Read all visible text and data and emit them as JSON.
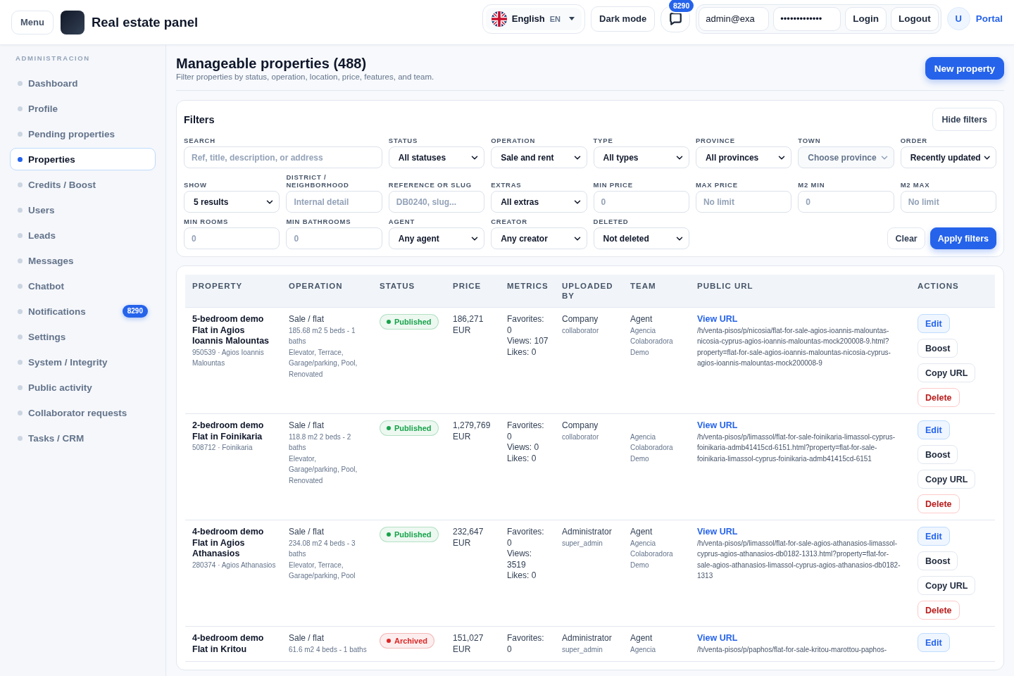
{
  "header": {
    "menu_button": "Menu",
    "title": "Real estate panel",
    "language": {
      "name": "English",
      "code": "EN"
    },
    "dark_mode_button": "Dark mode",
    "notifications": {
      "count": "8290"
    },
    "login": {
      "email": "admin@exa",
      "password": "•••••••••••••",
      "buttons": [
        "Login",
        "Logout"
      ]
    },
    "avatar": "U",
    "portal_link": "Portal"
  },
  "sidebar": {
    "section": "ADMINISTRACION",
    "items": [
      {
        "label": "Dashboard",
        "selected": false
      },
      {
        "label": "Profile",
        "selected": false
      },
      {
        "label": "Pending properties",
        "selected": false
      },
      {
        "label": "Properties",
        "selected": true
      },
      {
        "label": "Credits / Boost",
        "selected": false
      },
      {
        "label": "Users",
        "selected": false
      },
      {
        "label": "Leads",
        "selected": false
      },
      {
        "label": "Messages",
        "selected": false
      },
      {
        "label": "Chatbot",
        "selected": false
      },
      {
        "label": "Notifications",
        "selected": false,
        "badge": "8290"
      },
      {
        "label": "Settings",
        "selected": false
      },
      {
        "label": "System / Integrity",
        "selected": false
      },
      {
        "label": "Public activity",
        "selected": false
      },
      {
        "label": "Collaborator requests",
        "selected": false
      },
      {
        "label": "Tasks / CRM",
        "selected": false
      }
    ]
  },
  "page": {
    "title": "Manageable properties (488)",
    "subtitle": "Filter properties by status, operation, location, price, features, and team.",
    "new_button": "New property"
  },
  "filters": {
    "heading": "Filters",
    "hide_button": "Hide filters",
    "fields": [
      {
        "label": "SEARCH",
        "kind": "search",
        "placeholder": "Ref, title, description, or address",
        "disabled": false
      },
      {
        "label": "STATUS",
        "kind": "select",
        "value": "All statuses",
        "disabled": false
      },
      {
        "label": "OPERATION",
        "kind": "select",
        "value": "Sale and rent",
        "disabled": false
      },
      {
        "label": "TYPE",
        "kind": "select",
        "value": "All types",
        "disabled": false
      },
      {
        "label": "PROVINCE",
        "kind": "select",
        "value": "All provinces",
        "disabled": false
      },
      {
        "label": "TOWN",
        "kind": "select",
        "value": "Choose province",
        "disabled": true
      },
      {
        "label": "ORDER",
        "kind": "select",
        "value": "Recently updated",
        "disabled": false
      },
      {
        "label": "SHOW",
        "kind": "select",
        "value": "5 results",
        "disabled": false
      },
      {
        "label": "DISTRICT / NEIGHBORHOOD",
        "kind": "input",
        "placeholder": "Internal detail",
        "disabled": false
      },
      {
        "label": "REFERENCE OR SLUG",
        "kind": "input",
        "placeholder": "DB0240, slug...",
        "disabled": false
      },
      {
        "label": "EXTRAS",
        "kind": "select",
        "value": "All extras",
        "disabled": false
      },
      {
        "label": "MIN PRICE",
        "kind": "input",
        "placeholder": "0",
        "disabled": false
      },
      {
        "label": "MAX PRICE",
        "kind": "input",
        "placeholder": "No limit",
        "disabled": false
      },
      {
        "label": "M2 MIN",
        "kind": "input",
        "placeholder": "0",
        "disabled": false
      },
      {
        "label": "M2 MAX",
        "kind": "input",
        "placeholder": "No limit",
        "disabled": false
      },
      {
        "label": "MIN ROOMS",
        "kind": "input",
        "placeholder": "0",
        "disabled": false
      },
      {
        "label": "MIN BATHROOMS",
        "kind": "input",
        "placeholder": "0",
        "disabled": false
      },
      {
        "label": "AGENT",
        "kind": "select",
        "value": "Any agent",
        "disabled": false
      },
      {
        "label": "CREATOR",
        "kind": "select",
        "value": "Any creator",
        "disabled": false
      },
      {
        "label": "DELETED",
        "kind": "select",
        "value": "Not deleted",
        "disabled": false
      }
    ],
    "actions": [
      {
        "label": "Clear",
        "kind": "reset"
      },
      {
        "label": "Apply filters",
        "kind": "submit"
      }
    ]
  },
  "table": {
    "columns": [
      "PROPERTY",
      "OPERATION",
      "STATUS",
      "PRICE",
      "METRICS",
      "UPLOADED BY",
      "TEAM",
      "PUBLIC URL",
      "ACTIONS"
    ],
    "rows": [
      {
        "property": {
          "title": "5-bedroom demo Flat in Agios Ioannis Malountas",
          "meta": "950539 · Agios Ioannis Malountas"
        },
        "operation": {
          "type": "Sale / flat",
          "details": "185.68 m2 5 beds - 1 baths",
          "features": "Elevator, Terrace, Garage/parking, Pool, Renovated"
        },
        "status": {
          "label": "Published",
          "color": "#16a34a"
        },
        "price": "186,271 EUR",
        "metrics": [
          "Favorites: 0",
          "Views: 107",
          "Likes: 0"
        ],
        "uploaded_by": {
          "name": "Company",
          "role": "collaborator"
        },
        "team": {
          "agent": "Agent",
          "name": "Agencia Colaboradora Demo"
        },
        "public_url": {
          "link": "View URL",
          "path": "/h/venta-pisos/p/nicosia/flat-for-sale-agios-ioannis-malountas-nicosia-cyprus-agios-ioannis-malountas-mock200008-9.html?property=flat-for-sale-agios-ioannis-malountas-nicosia-cyprus-agios-ioannis-malountas-mock200008-9"
        },
        "actions": [
          {
            "label": "Edit",
            "kind": "edit"
          },
          {
            "label": "Boost",
            "kind": "boost"
          },
          {
            "label": "Copy URL",
            "kind": "copy"
          },
          {
            "label": "Delete",
            "kind": "delete"
          }
        ]
      },
      {
        "property": {
          "title": "2-bedroom demo Flat in Foinikaria",
          "meta": "508712 · Foinikaria"
        },
        "operation": {
          "type": "Sale / flat",
          "details": "118.8 m2 2 beds - 2 baths",
          "features": "Elevator, Garage/parking, Pool, Renovated"
        },
        "status": {
          "label": "Published",
          "color": "#16a34a"
        },
        "price": "1,279,769 EUR",
        "metrics": [
          "Favorites: 0",
          "Views: 0",
          "Likes: 0"
        ],
        "uploaded_by": {
          "name": "Company",
          "role": "collaborator"
        },
        "team": {
          "name": "Agencia Colaboradora Demo"
        },
        "public_url": {
          "link": "View URL",
          "path": "/h/venta-pisos/p/limassol/flat-for-sale-foinikaria-limassol-cyprus-foinikaria-admb41415cd-6151.html?property=flat-for-sale-foinikaria-limassol-cyprus-foinikaria-admb41415cd-6151"
        },
        "actions": [
          {
            "label": "Edit",
            "kind": "edit"
          },
          {
            "label": "Boost",
            "kind": "boost"
          },
          {
            "label": "Copy URL",
            "kind": "copy"
          },
          {
            "label": "Delete",
            "kind": "delete"
          }
        ]
      },
      {
        "property": {
          "title": "4-bedroom demo Flat in Agios Athanasios",
          "meta": "280374 · Agios Athanasios"
        },
        "operation": {
          "type": "Sale / flat",
          "details": "234.08 m2 4 beds - 3 baths",
          "features": "Elevator, Terrace, Garage/parking, Pool"
        },
        "status": {
          "label": "Published",
          "color": "#16a34a"
        },
        "price": "232,647 EUR",
        "metrics": [
          "Favorites: 0",
          "Views: 3519",
          "Likes: 0"
        ],
        "uploaded_by": {
          "name": "Administrator",
          "role": "super_admin"
        },
        "team": {
          "agent": "Agent",
          "name": "Agencia Colaboradora Demo"
        },
        "public_url": {
          "link": "View URL",
          "path": "/h/venta-pisos/p/limassol/flat-for-sale-agios-athanasios-limassol-cyprus-agios-athanasios-db0182-1313.html?property=flat-for-sale-agios-athanasios-limassol-cyprus-agios-athanasios-db0182-1313"
        },
        "actions": [
          {
            "label": "Edit",
            "kind": "edit"
          },
          {
            "label": "Boost",
            "kind": "boost"
          },
          {
            "label": "Copy URL",
            "kind": "copy"
          },
          {
            "label": "Delete",
            "kind": "delete"
          }
        ]
      },
      {
        "property": {
          "title": "4-bedroom demo Flat in Kritou"
        },
        "operation": {
          "type": "Sale / flat",
          "details": "61.6 m2 4 beds - 1 baths"
        },
        "status": {
          "label": "Archived",
          "color": "#dc2626"
        },
        "price": "151,027 EUR",
        "metrics": [
          "Favorites: 0"
        ],
        "uploaded_by": {
          "name": "Administrator",
          "role": "super_admin"
        },
        "team": {
          "agent": "Agent",
          "name": "Agencia"
        },
        "public_url": {
          "link": "View URL",
          "path": "/h/venta-pisos/p/paphos/flat-for-sale-kritou-marottou-paphos-"
        },
        "actions": [
          {
            "label": "Edit",
            "kind": "edit"
          }
        ]
      }
    ]
  }
}
